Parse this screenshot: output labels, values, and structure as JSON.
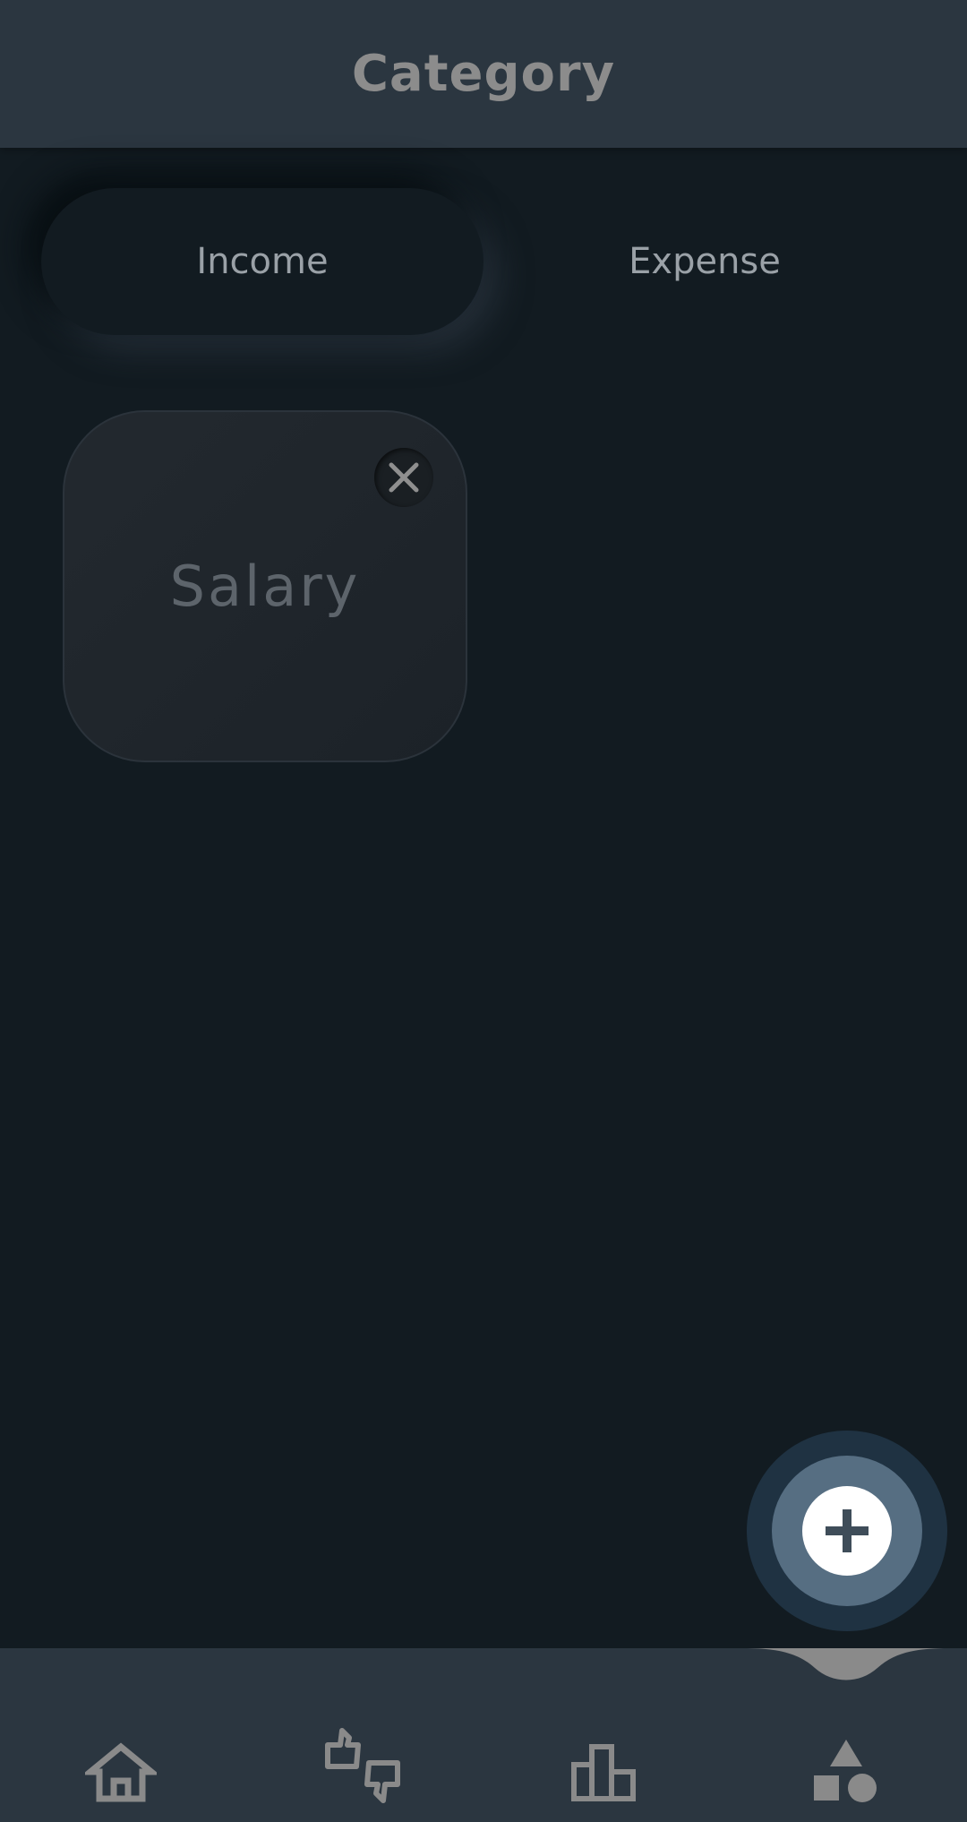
{
  "header": {
    "title": "Category"
  },
  "tabs": [
    {
      "label": "Income",
      "selected": true
    },
    {
      "label": "Expense",
      "selected": false
    }
  ],
  "categories": [
    {
      "label": "Salary",
      "delete_icon": "close-icon"
    }
  ],
  "fab": {
    "icon": "plus-icon"
  },
  "bottom_nav": {
    "items": [
      {
        "icon": "home-icon"
      },
      {
        "icon": "thumbs-up-down-icon"
      },
      {
        "icon": "bar-chart-icon"
      },
      {
        "icon": "shapes-icon",
        "active": true
      }
    ]
  },
  "colors": {
    "background": "#121b21",
    "header": "#2b3640",
    "text_muted": "#8c8c8c",
    "fab_ring": "#1f3242",
    "fab": "#566e82"
  }
}
